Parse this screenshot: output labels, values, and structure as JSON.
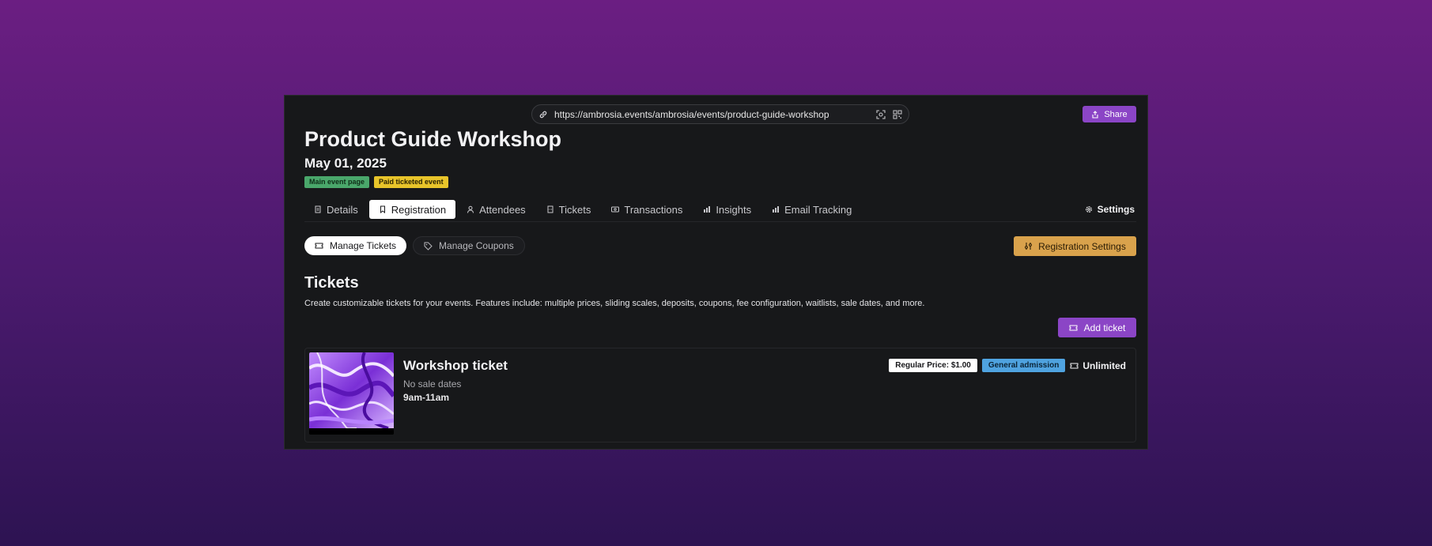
{
  "browser": {
    "url": "https://ambrosia.events/ambrosia/events/product-guide-workshop",
    "share_label": "Share"
  },
  "event": {
    "title": "Product Guide Workshop",
    "date": "May 01, 2025",
    "badges": [
      "Main event page",
      "Paid ticketed event"
    ]
  },
  "tabs": {
    "items": [
      {
        "label": "Details",
        "icon": "document-icon"
      },
      {
        "label": "Registration",
        "icon": "bookmark-icon",
        "active": true
      },
      {
        "label": "Attendees",
        "icon": "user-icon"
      },
      {
        "label": "Tickets",
        "icon": "ticket-icon"
      },
      {
        "label": "Transactions",
        "icon": "card-icon"
      },
      {
        "label": "Insights",
        "icon": "bar-chart-icon"
      },
      {
        "label": "Email Tracking",
        "icon": "bar-chart-icon"
      }
    ],
    "settings_label": "Settings"
  },
  "subtabs": {
    "manage_tickets": "Manage Tickets",
    "manage_coupons": "Manage Coupons",
    "registration_settings": "Registration Settings"
  },
  "tickets_section": {
    "title": "Tickets",
    "description": "Create customizable tickets for your events. Features include: multiple prices, sliding scales, deposits, coupons, fee configuration, waitlists, sale dates, and more.",
    "add_label": "Add ticket"
  },
  "ticket": {
    "name": "Workshop ticket",
    "sale_dates": "No sale dates",
    "time": "9am-11am",
    "price_label": "Regular Price: $1.00",
    "type_label": "General admission",
    "quantity_label": "Unlimited"
  },
  "colors": {
    "accent_purple": "#8b45c6",
    "settings_gold": "#d9a24c",
    "badge_green": "#4aa76b",
    "badge_yellow": "#e8c42a",
    "tag_blue": "#4fa3e0"
  }
}
